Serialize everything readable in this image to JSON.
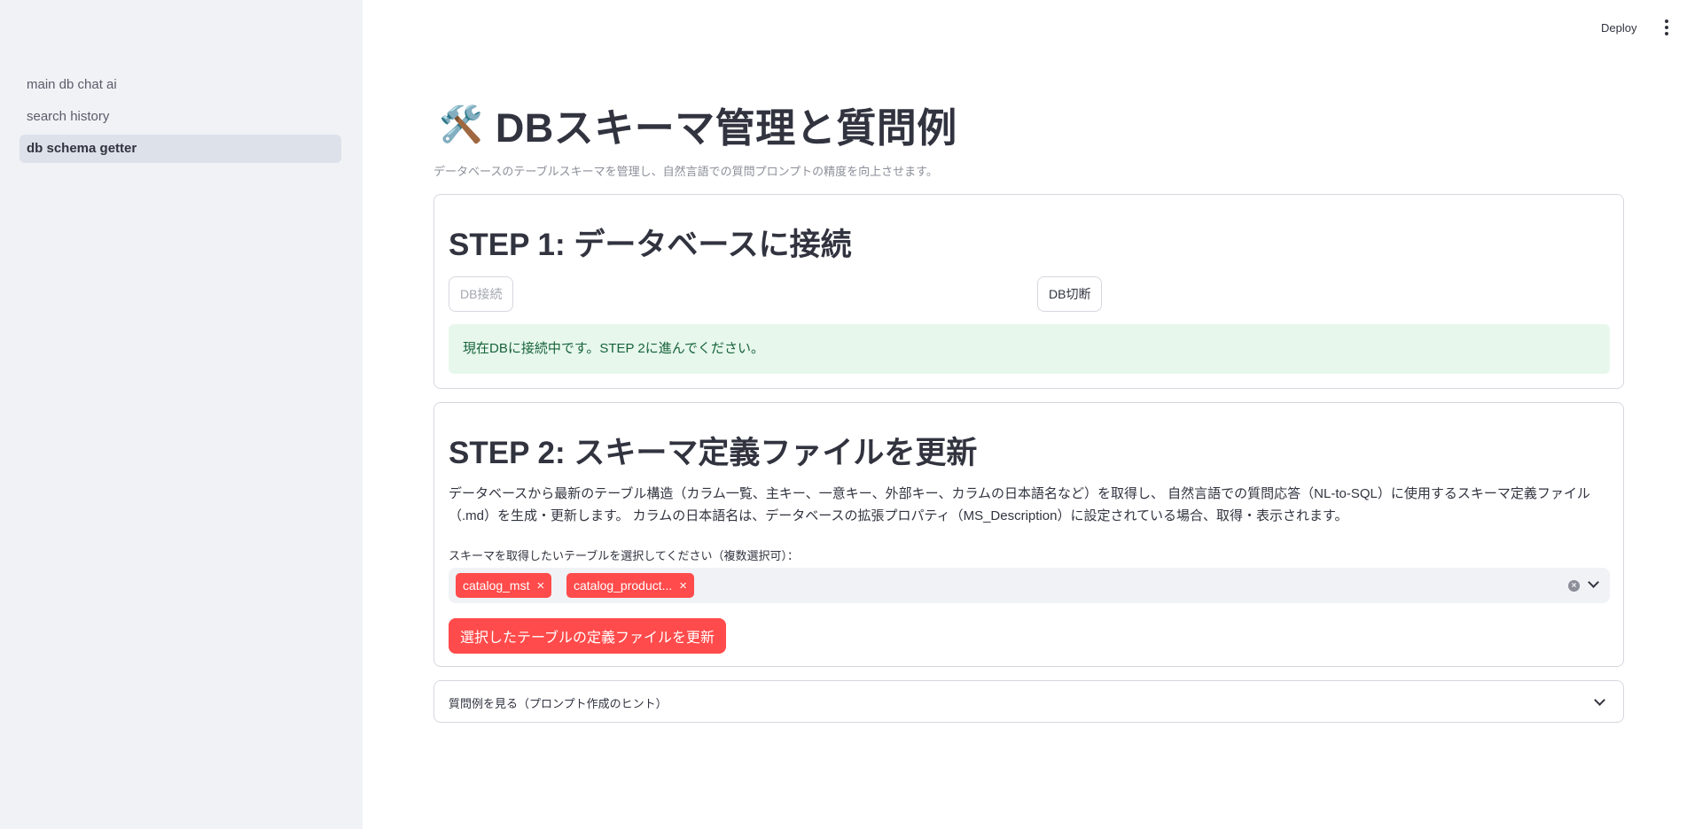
{
  "header": {
    "deploy_label": "Deploy",
    "menu_icon": "kebab-menu-icon"
  },
  "sidebar": {
    "items": [
      {
        "label": "main db chat ai",
        "active": false
      },
      {
        "label": "search history",
        "active": false
      },
      {
        "label": "db schema getter",
        "active": true
      }
    ]
  },
  "page": {
    "icon": "🛠️",
    "title": "DBスキーマ管理と質問例",
    "caption": "データベースのテーブルスキーマを管理し、自然言語での質問プロンプトの精度を向上させます。"
  },
  "step1": {
    "heading": "STEP 1: データベースに接続",
    "connect_label": "DB接続",
    "disconnect_label": "DB切断",
    "status": "現在DBに接続中です。STEP 2に進んでください。"
  },
  "step2": {
    "heading": "STEP 2: スキーマ定義ファイルを更新",
    "description": "データベースから最新のテーブル構造（カラム一覧、主キー、一意キー、外部キー、カラムの日本語名など）を取得し、 自然言語での質問応答（NL-to-SQL）に使用するスキーマ定義ファイル（.md）を生成・更新します。 カラムの日本語名は、データベースの拡張プロパティ（MS_Description）に設定されている場合、取得・表示されます。",
    "select_label": "スキーマを取得したいテーブルを選択してください（複数選択可）：",
    "selected_tables": [
      "catalog_mst",
      "catalog_product..."
    ],
    "update_label": "選択したテーブルの定義ファイルを更新"
  },
  "expander": {
    "label": "質問例を見る（プロンプト作成のヒント）"
  },
  "colors": {
    "accent": "#ff4b4b",
    "success_bg": "#e7f7ec",
    "success_text": "#17633a",
    "sidebar_bg": "#f0f2f6"
  }
}
